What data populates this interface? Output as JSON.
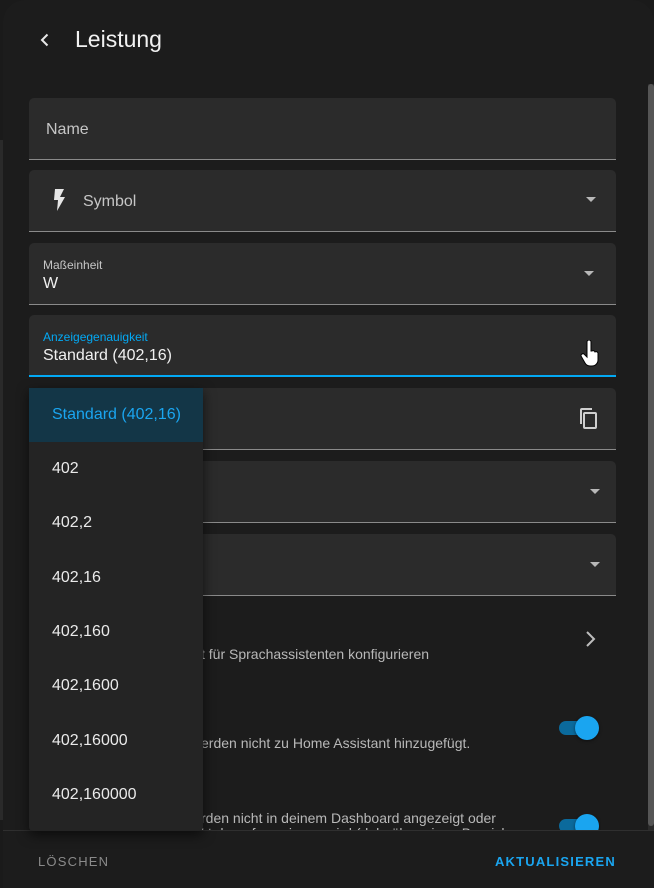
{
  "header": {
    "title": "Leistung"
  },
  "fields": {
    "name": {
      "placeholder": "Name"
    },
    "symbol": {
      "placeholder": "Symbol",
      "icon": "lightning-bolt-icon"
    },
    "unit": {
      "label": "Maßeinheit",
      "value": "W"
    },
    "precision": {
      "label": "Anzeigegenauigkeit",
      "value": "Standard (402,16)"
    }
  },
  "rows": {
    "voice": {
      "text": "t für Sprachassistenten konfigurieren"
    },
    "enabled": {
      "text": "erden nicht zu Home Assistant hinzugefügt.",
      "on": true
    },
    "visible": {
      "text_line1": "rden nicht in deinem Dashboard angezeigt oder",
      "text_line2": "kt darauf verwiesen wird (d. h. über einen Bereich",
      "on": true
    }
  },
  "precision_menu": {
    "selected": "Standard (402,16)",
    "options": [
      "Standard (402,16)",
      "402",
      "402,2",
      "402,16",
      "402,160",
      "402,1600",
      "402,16000",
      "402,160000"
    ]
  },
  "footer": {
    "delete_label": "LÖSCHEN",
    "update_label": "AKTUALISIEREN"
  },
  "colors": {
    "accent": "#03a9f4",
    "surface": "#2b2b2b",
    "background": "#1c1c1c"
  }
}
